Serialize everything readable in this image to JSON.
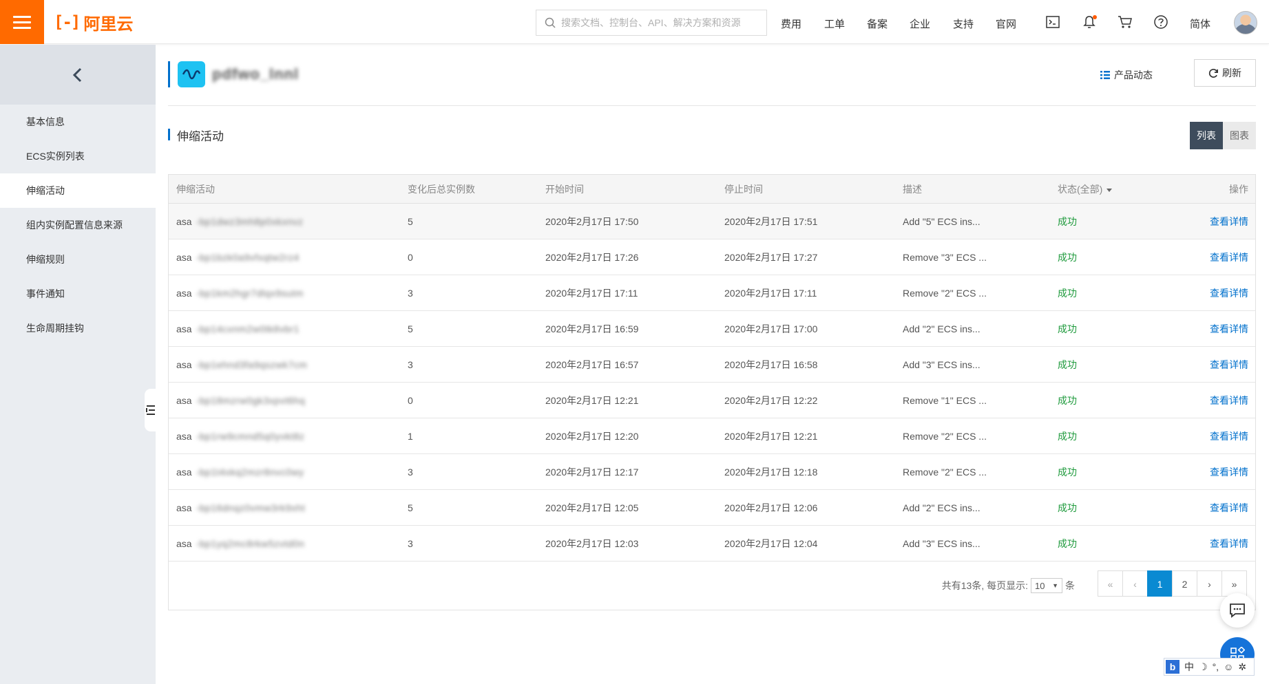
{
  "brand": {
    "name": "阿里云",
    "mark": "[-]"
  },
  "search": {
    "placeholder": "搜索文档、控制台、API、解决方案和资源"
  },
  "nav": {
    "cost": "费用",
    "ticket": "工单",
    "icp": "备案",
    "enterprise": "企业",
    "support": "支持",
    "site": "官网",
    "lang": "简体"
  },
  "sidebar": {
    "items": [
      {
        "label": "基本信息"
      },
      {
        "label": "ECS实例列表"
      },
      {
        "label": "伸缩活动"
      },
      {
        "label": "组内实例配置信息来源"
      },
      {
        "label": "伸缩规则"
      },
      {
        "label": "事件通知"
      },
      {
        "label": "生命周期挂钩"
      }
    ]
  },
  "header": {
    "app_name": "pdfwo_lnnl",
    "dynamics": "产品动态",
    "refresh": "刷新"
  },
  "section": {
    "title": "伸缩活动"
  },
  "view": {
    "list": "列表",
    "chart": "图表"
  },
  "table": {
    "columns": [
      "伸缩活动",
      "变化后总实例数",
      "开始时间",
      "停止时间",
      "描述",
      "状态(全部)",
      "操作"
    ],
    "rows": [
      {
        "prefix": "asa",
        "id": "-bp1dwz3mh8p0xkxnvz",
        "count": "5",
        "start": "2020年2月17日 17:50",
        "end": "2020年2月17日 17:51",
        "desc": "Add \"5\" ECS ins...",
        "status": "成功",
        "action": "查看详情"
      },
      {
        "prefix": "asa",
        "id": "-bp1bzk0a9vfxqtw2rz4",
        "count": "0",
        "start": "2020年2月17日 17:26",
        "end": "2020年2月17日 17:27",
        "desc": "Remove \"3\" ECS ...",
        "status": "成功",
        "action": "查看详情"
      },
      {
        "prefix": "asa",
        "id": "-bp1km2hgr7dlqx9sutm",
        "count": "3",
        "start": "2020年2月17日 17:11",
        "end": "2020年2月17日 17:11",
        "desc": "Remove \"2\" ECS ...",
        "status": "成功",
        "action": "查看详情"
      },
      {
        "prefix": "asa",
        "id": "-bp14cxnm2w0tk8vbr1",
        "count": "5",
        "start": "2020年2月17日 16:59",
        "end": "2020年2月17日 17:00",
        "desc": "Add \"2\" ECS ins...",
        "status": "成功",
        "action": "查看详情"
      },
      {
        "prefix": "asa",
        "id": "-bp1ehnd3fa9qszwk7cm",
        "count": "3",
        "start": "2020年2月17日 16:57",
        "end": "2020年2月17日 16:58",
        "desc": "Add \"3\" ECS ins...",
        "status": "成功",
        "action": "查看详情"
      },
      {
        "prefix": "asa",
        "id": "-bp18mzrw0gk3xpvt6hq",
        "count": "0",
        "start": "2020年2月17日 12:21",
        "end": "2020年2月17日 12:22",
        "desc": "Remove \"1\" ECS ...",
        "status": "成功",
        "action": "查看详情"
      },
      {
        "prefix": "asa",
        "id": "-bp1rw9cmnd5q0yvkt8z",
        "count": "1",
        "start": "2020年2月17日 12:20",
        "end": "2020年2月17日 12:21",
        "desc": "Remove \"2\" ECS ...",
        "status": "成功",
        "action": "查看详情"
      },
      {
        "prefix": "asa",
        "id": "-bp1t4xkq2mzr8nvc0wy",
        "count": "3",
        "start": "2020年2月17日 12:17",
        "end": "2020年2月17日 12:18",
        "desc": "Remove \"2\" ECS ...",
        "status": "成功",
        "action": "查看详情"
      },
      {
        "prefix": "asa",
        "id": "-bp16dnqz0vmw3rk9xht",
        "count": "5",
        "start": "2020年2月17日 12:05",
        "end": "2020年2月17日 12:06",
        "desc": "Add \"2\" ECS ins...",
        "status": "成功",
        "action": "查看详情"
      },
      {
        "prefix": "asa",
        "id": "-bp1yq2mc8rkw5zvtd0n",
        "count": "3",
        "start": "2020年2月17日 12:03",
        "end": "2020年2月17日 12:04",
        "desc": "Add \"3\" ECS ins...",
        "status": "成功",
        "action": "查看详情"
      }
    ]
  },
  "pagination": {
    "total_text": "共有13条, 每页显示:",
    "page_size": "10",
    "unit": "条",
    "first": "«",
    "prev": "‹",
    "pages": [
      "1",
      "2"
    ],
    "next": "›",
    "last": "»"
  },
  "ime": {
    "label": "中",
    "logo": "b"
  }
}
